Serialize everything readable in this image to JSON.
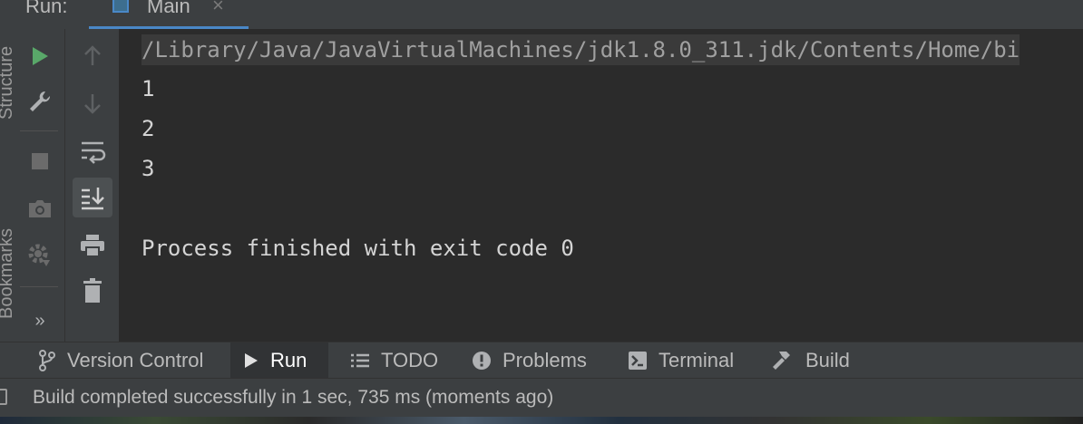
{
  "run_panel": {
    "label": "Run:",
    "tab": {
      "title": "Main",
      "close": "×"
    }
  },
  "left_strip": {
    "labels": [
      "Structure",
      "Bookmarks"
    ]
  },
  "toolbar_primary": {
    "items": [
      {
        "icon": "play-icon",
        "color": "#59a869"
      },
      {
        "icon": "wrench-icon"
      },
      {
        "icon": "stop-icon"
      },
      {
        "icon": "camera-icon"
      },
      {
        "icon": "debug-settings-icon"
      },
      {
        "icon": "more-chevron-icon",
        "label": "»"
      }
    ]
  },
  "toolbar_secondary": {
    "items": [
      {
        "icon": "arrow-up-icon"
      },
      {
        "icon": "arrow-down-icon"
      },
      {
        "icon": "soft-wrap-icon"
      },
      {
        "icon": "scroll-to-end-icon",
        "active": true
      },
      {
        "icon": "print-icon"
      },
      {
        "icon": "trash-icon"
      }
    ]
  },
  "console": {
    "command": "/Library/Java/JavaVirtualMachines/jdk1.8.0_311.jdk/Contents/Home/bi",
    "output": [
      "1",
      "2",
      "3"
    ],
    "exit_message": "Process finished with exit code 0"
  },
  "bottom_tabs": [
    {
      "label": "Version Control",
      "icon": "branch-icon"
    },
    {
      "label": "Run",
      "icon": "run-triangle-icon",
      "active": true
    },
    {
      "label": "TODO",
      "icon": "list-icon"
    },
    {
      "label": "Problems",
      "icon": "exclamation-circle-icon"
    },
    {
      "label": "Terminal",
      "icon": "terminal-icon"
    },
    {
      "label": "Build",
      "icon": "hammer-icon"
    }
  ],
  "status_bar": {
    "message": "Build completed successfully in 1 sec, 735 ms (moments ago)"
  },
  "colors": {
    "accent": "#4a88c7",
    "run_green": "#59a869",
    "panel": "#3c3f41",
    "editor": "#2b2b2b"
  }
}
